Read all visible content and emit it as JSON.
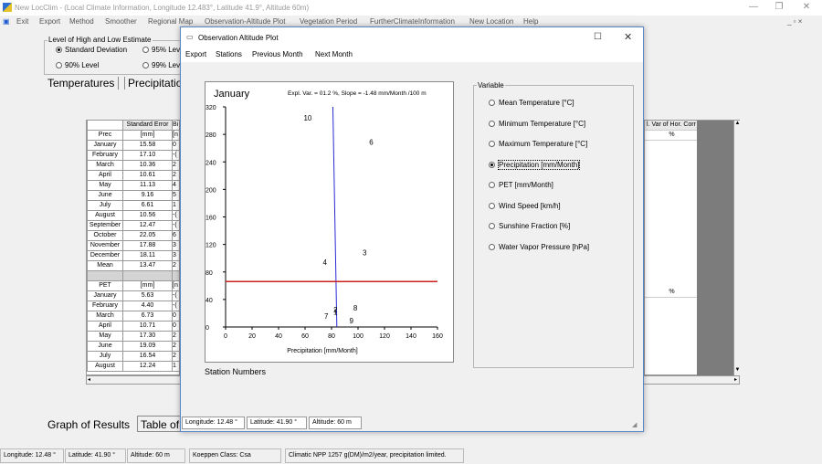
{
  "window": {
    "title": "New LocClim - (Local Climate Information, Longitude 12.483°, Latitude 41.9°, Altitude 60m)",
    "minimize": "—",
    "maximize": "❐",
    "close": "✕"
  },
  "menubar": {
    "exit": "Exit",
    "items": [
      "Export",
      "Method",
      "Smoother",
      "Regional Map",
      "Observation-Altitude Plot",
      "Vegetation Period",
      "FurtherClimateInformation",
      "New Location",
      "Help"
    ],
    "mdi_controls": "_ ▫ ×"
  },
  "estimate": {
    "legend": "Level of High and Low Estimate",
    "options": [
      "Standard Deviation",
      "95% Level",
      "90% Level",
      "99% Level"
    ],
    "selected": "Standard Deviation"
  },
  "tabs": [
    "Temperatures",
    "Precipitation"
  ],
  "table": {
    "header": [
      "",
      "Standard Error",
      "Bi"
    ],
    "units_row": [
      "Prec",
      "[mm]",
      "[n"
    ],
    "prec_rows": [
      [
        "January",
        "15.58",
        "0"
      ],
      [
        "February",
        "17.10",
        "-("
      ],
      [
        "March",
        "10.36",
        "2"
      ],
      [
        "April",
        "10.61",
        "2"
      ],
      [
        "May",
        "11.13",
        "4"
      ],
      [
        "June",
        "9.16",
        "5"
      ],
      [
        "July",
        "6.61",
        "1"
      ],
      [
        "August",
        "10.56",
        "-("
      ],
      [
        "September",
        "12.47",
        "-("
      ],
      [
        "October",
        "22.05",
        "6"
      ],
      [
        "November",
        "17.88",
        "3"
      ],
      [
        "December",
        "18.11",
        "3"
      ],
      [
        "Mean",
        "13.47",
        "2"
      ]
    ],
    "pet_units_row": [
      "PET",
      "[mm]",
      "[n"
    ],
    "pet_rows": [
      [
        "January",
        "5.63",
        "-("
      ],
      [
        "February",
        "4.40",
        "-("
      ],
      [
        "March",
        "6.73",
        "0"
      ],
      [
        "April",
        "10.71",
        "0"
      ],
      [
        "May",
        "17.30",
        "2"
      ],
      [
        "June",
        "19.09",
        "2"
      ],
      [
        "July",
        "16.54",
        "2"
      ],
      [
        "August",
        "12.24",
        "1"
      ]
    ]
  },
  "right_table": {
    "header": "l. Var of Hor. Corr",
    "unit1": "%",
    "unit2": "%"
  },
  "dialog": {
    "title": "Observation Altitude Plot",
    "menu": [
      "Export",
      "Stations",
      "Previous Month",
      "Next Month"
    ],
    "station_numbers_label": "Station Numbers",
    "status": [
      "Longitude: 12.48 °",
      "Latitude: 41.90 °",
      "Altitude: 60 m"
    ]
  },
  "variable": {
    "legend": "Variable",
    "options": [
      "Mean Temperature [°C]",
      "Minimum Temperature [°C]",
      "Maximum Temperature [°C]",
      "Precipitation [mm/Month]",
      "PET [mm/Month]",
      "Wind Speed [km/h]",
      "Sunshine Fraction [%]",
      "Water Vapor Pressure [hPa]"
    ],
    "selected": "Precipitation [mm/Month]"
  },
  "bottom_tabs": [
    "Graph of Results",
    "Table of"
  ],
  "status_bar": [
    "Longitude: 12.48 °",
    "Latitude: 41.90 °",
    "Altitude: 60 m",
    "Koeppen Class: Csa",
    "Climatic NPP 1257 g(DM)/m2/year, precipitation limited."
  ],
  "colors": {
    "accent": "#1e5bd1",
    "reference_line": "#cc1f1f",
    "regression_line": "#2a2ad6"
  },
  "chart_data": {
    "type": "scatter",
    "title": "January",
    "subtitle": "Expl. Var. = 01.2 %,  Slope = -1.48 mm/Month /100 m",
    "xlabel": "Precipitation [mm/Month]",
    "ylabel": "",
    "xlim": [
      0,
      160
    ],
    "ylim": [
      0,
      320
    ],
    "xticks": [
      0,
      20,
      40,
      60,
      80,
      100,
      120,
      140,
      160
    ],
    "yticks": [
      0,
      40,
      80,
      120,
      160,
      200,
      240,
      280,
      320
    ],
    "points": [
      {
        "label": "10",
        "x": 62,
        "y": 300
      },
      {
        "label": "6",
        "x": 110,
        "y": 265
      },
      {
        "label": "3",
        "x": 105,
        "y": 104
      },
      {
        "label": "4",
        "x": 75,
        "y": 90
      },
      {
        "label": "8",
        "x": 98,
        "y": 24
      },
      {
        "label": "2",
        "x": 83,
        "y": 21
      },
      {
        "label": "1",
        "x": 83,
        "y": 18
      },
      {
        "label": "7",
        "x": 76,
        "y": 12
      },
      {
        "label": "9",
        "x": 95,
        "y": 5
      }
    ],
    "regression_line": {
      "x": [
        81,
        84
      ],
      "y": [
        320,
        0
      ]
    },
    "reference_line": {
      "y": 66
    }
  }
}
